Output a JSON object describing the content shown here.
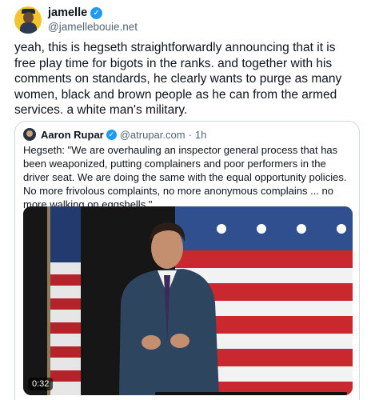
{
  "author": {
    "name": "jamelle",
    "handle": "@jamellebouie.net"
  },
  "tweet": {
    "text": "yeah, this is hegseth straightforwardly announcing that it is free play time for bigots in the ranks. and together with his comments on standards, he clearly wants to purge as many women, black and brown people as he can from the armed services. a white man's military."
  },
  "quote": {
    "name": "Aaron Rupar",
    "handle": "@atrupar.com",
    "separator": "·",
    "time": "1h",
    "text": "Hegseth: \"We are overhauling an inspector general process that has been weaponized, putting complainers and poor performers in the driver seat. We are doing the same with the equal opportunity policies. No more frivolous complaints, no more anonymous complains ... no more walking on eggshells.\"",
    "video": {
      "duration": "0:32"
    }
  },
  "colors": {
    "verified": "#1d9bf0",
    "text": "#0f1419",
    "secondary": "#536471",
    "border": "#cfd9de"
  }
}
